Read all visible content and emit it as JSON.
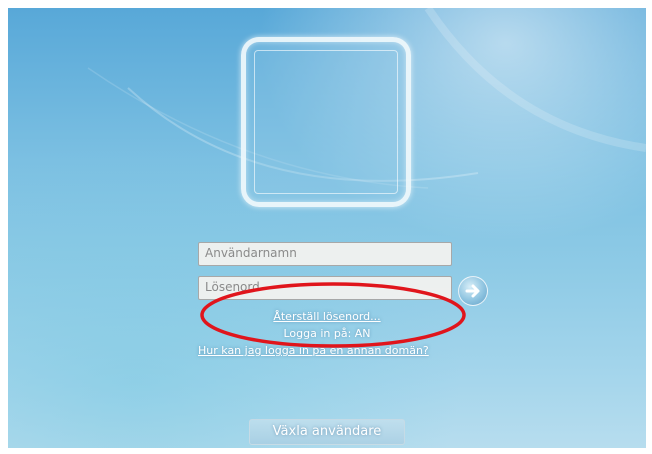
{
  "login": {
    "username_placeholder": "Användarnamn",
    "password_placeholder": "Lösenord",
    "submit_icon": "arrow-right-icon",
    "reset_password_link": "Återställ lösenord...",
    "logon_to_text": "Logga in på: AN",
    "domain_help_link": "Hur kan jag logga in på en annan domän?"
  },
  "footer": {
    "switch_user_label": "Växla användare"
  },
  "colors": {
    "annotation": "#e0151c",
    "background": "#7cc0e2"
  }
}
